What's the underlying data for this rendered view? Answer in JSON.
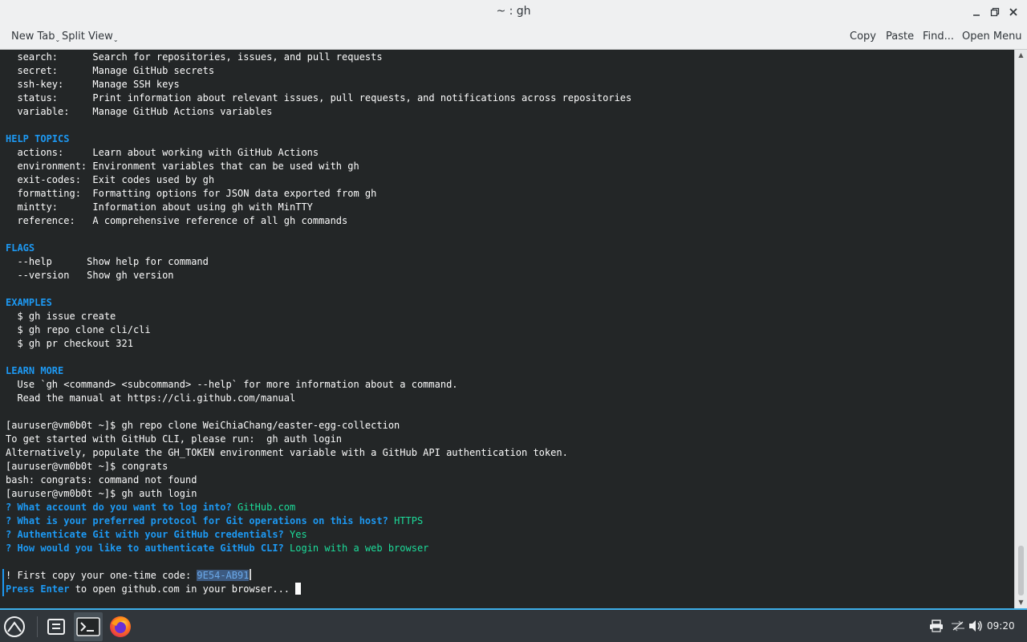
{
  "window": {
    "title": "~ : gh"
  },
  "toolbar": {
    "new_tab": "New Tab",
    "split_view": "Split View",
    "copy": "Copy",
    "paste": "Paste",
    "find": "Find...",
    "open_menu": "Open Menu"
  },
  "terminal": {
    "lines": [
      {
        "type": "text",
        "text": "  search:      Search for repositories, issues, and pull requests"
      },
      {
        "type": "text",
        "text": "  secret:      Manage GitHub secrets"
      },
      {
        "type": "text",
        "text": "  ssh-key:     Manage SSH keys"
      },
      {
        "type": "text",
        "text": "  status:      Print information about relevant issues, pull requests, and notifications across repositories"
      },
      {
        "type": "text",
        "text": "  variable:    Manage GitHub Actions variables"
      },
      {
        "type": "text",
        "text": ""
      },
      {
        "type": "header",
        "text": "HELP TOPICS"
      },
      {
        "type": "text",
        "text": "  actions:     Learn about working with GitHub Actions"
      },
      {
        "type": "text",
        "text": "  environment: Environment variables that can be used with gh"
      },
      {
        "type": "text",
        "text": "  exit-codes:  Exit codes used by gh"
      },
      {
        "type": "text",
        "text": "  formatting:  Formatting options for JSON data exported from gh"
      },
      {
        "type": "text",
        "text": "  mintty:      Information about using gh with MinTTY"
      },
      {
        "type": "text",
        "text": "  reference:   A comprehensive reference of all gh commands"
      },
      {
        "type": "text",
        "text": ""
      },
      {
        "type": "header",
        "text": "FLAGS"
      },
      {
        "type": "text",
        "text": "  --help      Show help for command"
      },
      {
        "type": "text",
        "text": "  --version   Show gh version"
      },
      {
        "type": "text",
        "text": ""
      },
      {
        "type": "header",
        "text": "EXAMPLES"
      },
      {
        "type": "text",
        "text": "  $ gh issue create"
      },
      {
        "type": "text",
        "text": "  $ gh repo clone cli/cli"
      },
      {
        "type": "text",
        "text": "  $ gh pr checkout 321"
      },
      {
        "type": "text",
        "text": ""
      },
      {
        "type": "header",
        "text": "LEARN MORE"
      },
      {
        "type": "text",
        "text": "  Use `gh <command> <subcommand> --help` for more information about a command."
      },
      {
        "type": "text",
        "text": "  Read the manual at https://cli.github.com/manual"
      },
      {
        "type": "text",
        "text": ""
      },
      {
        "type": "text",
        "text": "[auruser@vm0b0t ~]$ gh repo clone WeiChiaChang/easter-egg-collection"
      },
      {
        "type": "text",
        "text": "To get started with GitHub CLI, please run:  gh auth login"
      },
      {
        "type": "text",
        "text": "Alternatively, populate the GH_TOKEN environment variable with a GitHub API authentication token."
      },
      {
        "type": "text",
        "text": "[auruser@vm0b0t ~]$ congrats"
      },
      {
        "type": "text",
        "text": "bash: congrats: command not found"
      },
      {
        "type": "text",
        "text": "[auruser@vm0b0t ~]$ gh auth login"
      },
      {
        "type": "qa",
        "q": "? What account do you want to log into?",
        "a": "GitHub.com"
      },
      {
        "type": "qa",
        "q": "? What is your preferred protocol for Git operations on this host?",
        "a": "HTTPS"
      },
      {
        "type": "qa",
        "q": "? Authenticate Git with your GitHub credentials?",
        "a": "Yes"
      },
      {
        "type": "qa",
        "q": "? How would you like to authenticate GitHub CLI?",
        "a": "Login with a web browser"
      },
      {
        "type": "text",
        "text": ""
      },
      {
        "type": "code",
        "prefix": "! First copy your one-time code: ",
        "code": "9E54-AB91"
      },
      {
        "type": "enter",
        "lead": "Press Enter",
        "rest": " to open github.com in your browser... "
      }
    ]
  },
  "taskbar": {
    "clock": "09:20",
    "items": [
      "launcher-icon",
      "file-manager-icon",
      "terminal-icon",
      "firefox-icon"
    ],
    "tray": [
      "printer-icon",
      "network-icon",
      "volume-icon"
    ]
  },
  "colors": {
    "terminal_bg": "#232627",
    "header_blue": "#1d99f3",
    "answer_green": "#1cdc9a",
    "taskbar_bg": "#31363b",
    "accent": "#3daee9"
  }
}
